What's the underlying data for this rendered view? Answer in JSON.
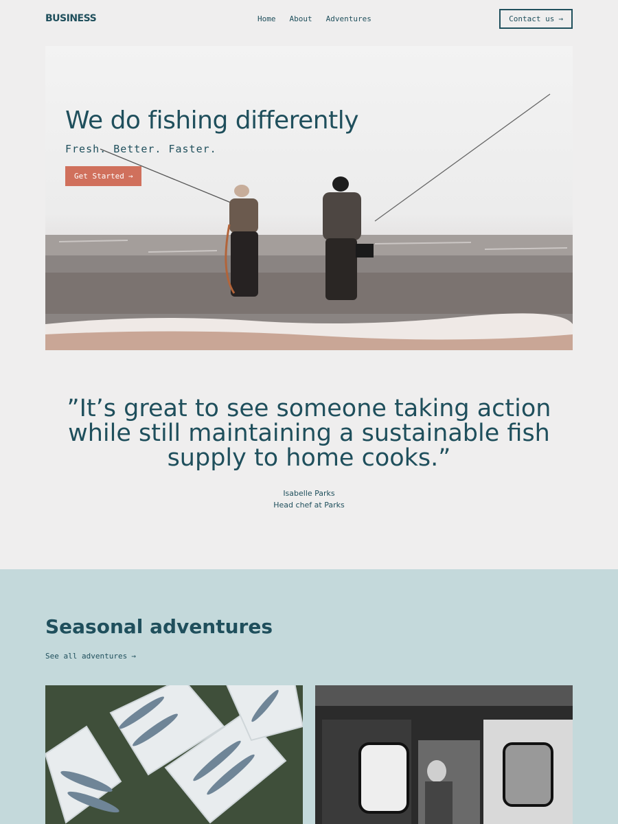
{
  "header": {
    "logo": "BUSINESS",
    "nav": [
      "Home",
      "About",
      "Adventures"
    ],
    "contact_label": "Contact us",
    "contact_icon": "arrow-right-icon"
  },
  "hero": {
    "title": "We do fishing differently",
    "subtitle": "Fresh. Better. Faster.",
    "cta_label": "Get Started",
    "cta_icon": "arrow-right-icon"
  },
  "testimonial": {
    "quote": "”It’s great to see someone taking action while still maintaining a sustainable fish supply to home cooks.”",
    "author_name": "Isabelle Parks",
    "author_role": "Head chef at Parks"
  },
  "seasonal": {
    "title": "Seasonal adventures",
    "see_all_label": "See all adventures",
    "see_all_icon": "arrow-right-icon"
  },
  "colors": {
    "primary": "#1f4f5c",
    "accent": "#d0705c",
    "background": "#efeeee",
    "section_bg": "#c4d9db"
  }
}
